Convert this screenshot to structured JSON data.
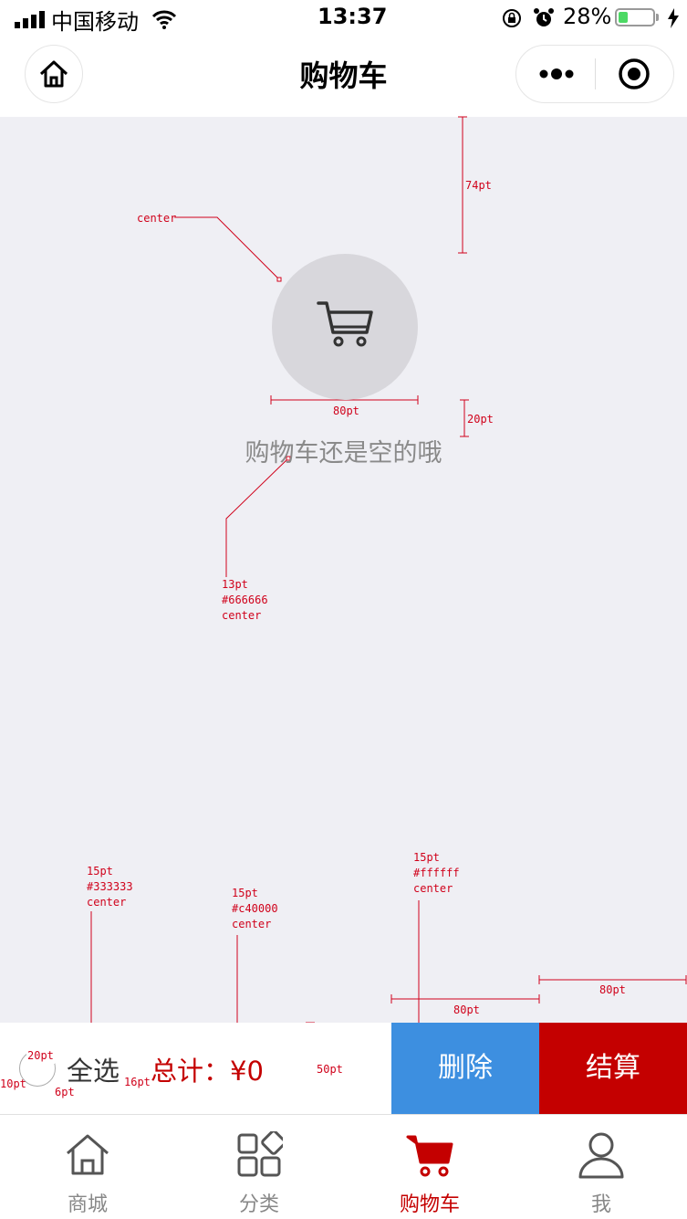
{
  "status_bar": {
    "carrier": "中国移动",
    "time": "13:37",
    "battery_percent": "28%",
    "battery_level": 0.28
  },
  "nav": {
    "title": "购物车"
  },
  "empty": {
    "message": "购物车还是空的哦"
  },
  "annotations": {
    "icon_align": "center",
    "top_gap": "74pt",
    "icon_size": "80pt",
    "text_gap": "20pt",
    "text_spec": [
      "13pt",
      "#666666",
      "center"
    ],
    "select_spec": [
      "15pt",
      "#333333",
      "center"
    ],
    "total_spec": [
      "15pt",
      "#c40000",
      "center"
    ],
    "delete_spec": [
      "15pt",
      "#ffffff",
      "center"
    ],
    "checkout_width": "80pt",
    "delete_width": "80pt",
    "bar_height": "50pt",
    "circle_size": "20pt",
    "left_pad": "10pt",
    "circle_gap": "6pt",
    "label_gap": "16pt"
  },
  "bottom_bar": {
    "select_all": "全选",
    "total": "总计：¥0",
    "delete": "删除",
    "checkout": "结算"
  },
  "tabs": [
    {
      "label": "商城",
      "icon": "home-icon",
      "active": false
    },
    {
      "label": "分类",
      "icon": "category-icon",
      "active": false
    },
    {
      "label": "购物车",
      "icon": "cart-icon",
      "active": true
    },
    {
      "label": "我",
      "icon": "user-icon",
      "active": false
    }
  ],
  "colors": {
    "accent": "#c40000",
    "delete": "#3d8fe0",
    "page_bg": "#efeff4",
    "annotation": "#d0021b"
  }
}
